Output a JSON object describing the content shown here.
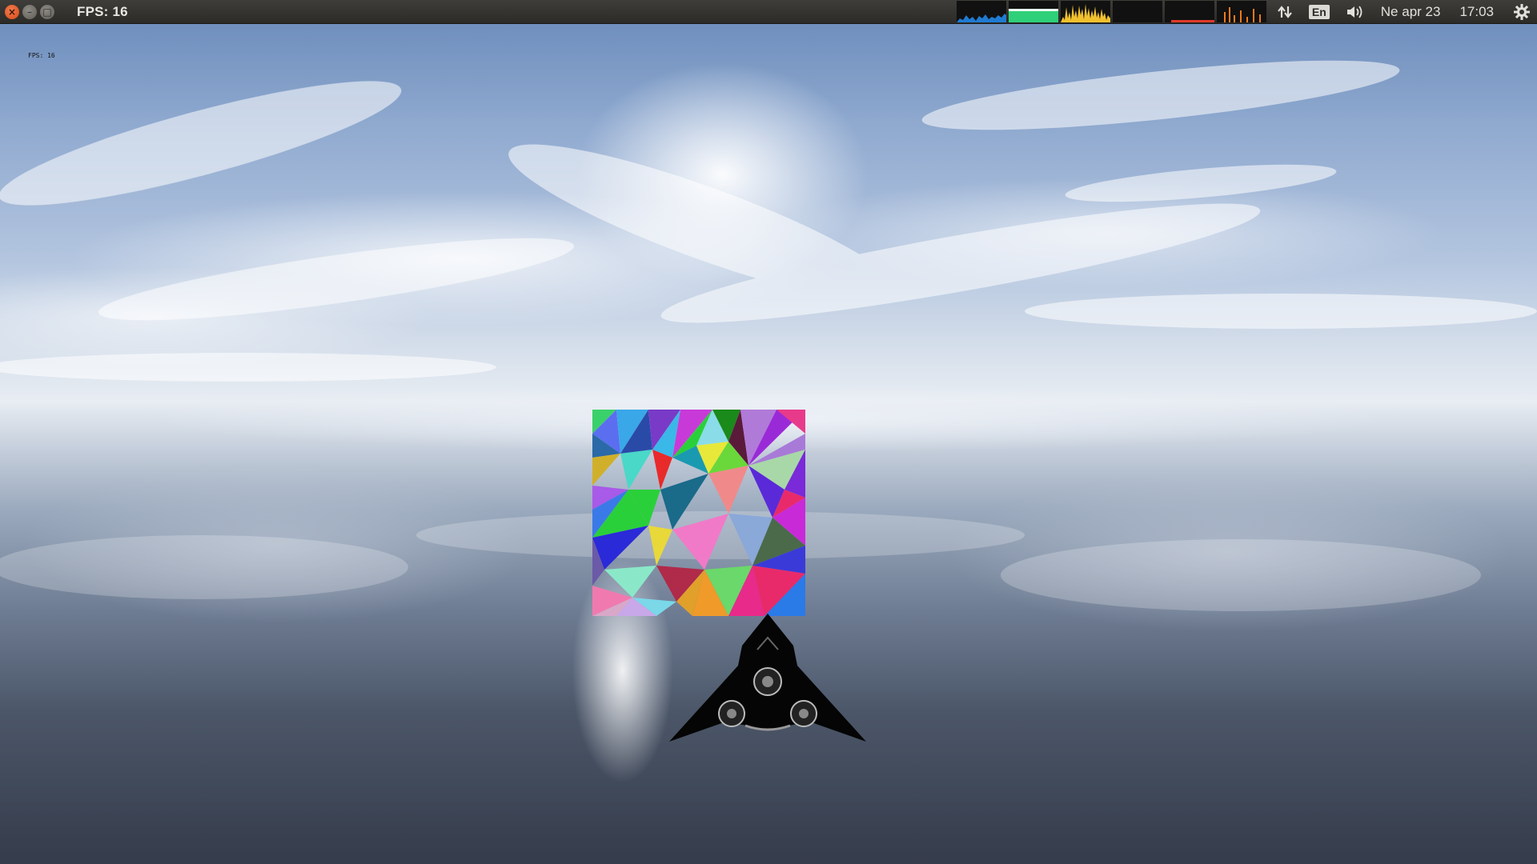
{
  "window": {
    "title": "FPS: 16",
    "close_icon": "close-icon",
    "minimize_icon": "minimize-icon",
    "maximize_icon": "maximize-icon"
  },
  "panel": {
    "language": "En",
    "date": "Ne apr 23",
    "time": "17:03",
    "network_icon": "network-updown-icon",
    "volume_icon": "volume-icon",
    "settings_icon": "gear-icon",
    "graph_colors": [
      "#1f7bd2",
      "#2fd07a",
      "#f2c12e",
      "#1a1a1a",
      "#e03a2a",
      "#f07a1a"
    ]
  },
  "scene": {
    "overlay_text": "FPS: 16",
    "mosaic_colors": [
      "#3ad16a",
      "#5b6ef0",
      "#3aa7e8",
      "#9a5ce8",
      "#e83a8a",
      "#f0c83a",
      "#2ad0b0",
      "#e84a3a",
      "#3ac83a",
      "#8a8aa8",
      "#f07aa8",
      "#3a3ad8",
      "#c83ad8",
      "#4a6a4a",
      "#e8a03a"
    ]
  }
}
